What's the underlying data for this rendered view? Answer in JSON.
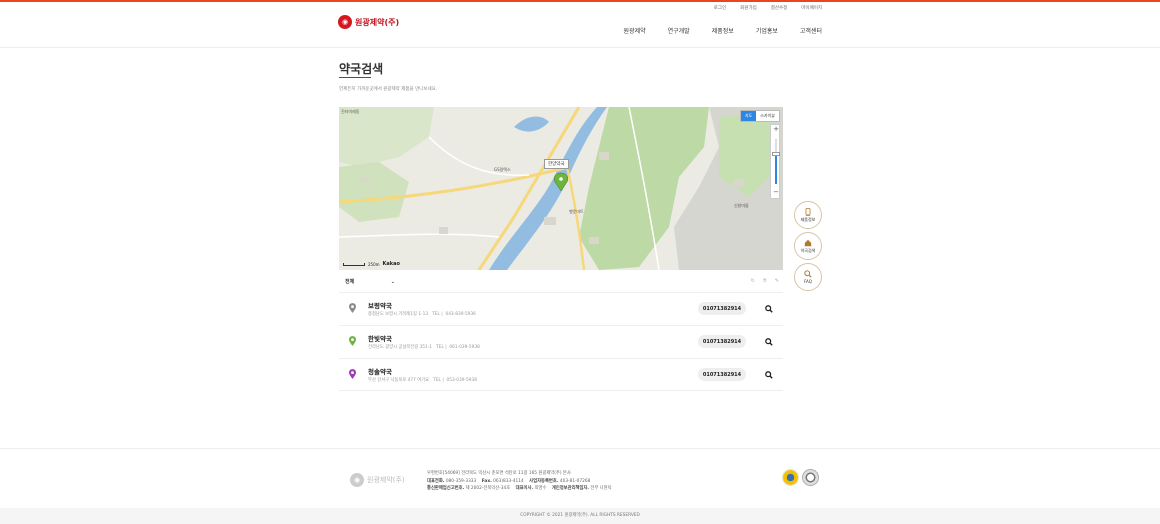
{
  "header": {
    "logo_text": "원광제약(주)",
    "util_links": [
      "로그인",
      "회원가입",
      "결산수정",
      "마이페이지"
    ],
    "nav": [
      "원광제약",
      "연구개발",
      "제품정보",
      "기업홍보",
      "고객센터"
    ]
  },
  "page": {
    "title": "약국검색",
    "subtitle": "언제든지 가까운곳에서 원광제약 제품을 만나보세요."
  },
  "map": {
    "type_buttons": [
      "지도",
      "스카이뷰"
    ],
    "active_type": "지도",
    "zoom_in": "+",
    "zoom_out": "−",
    "pin_label": "한양약국",
    "scale_label": "250m",
    "provider": "Kakao",
    "labels": [
      "진터미래동",
      "한양약국",
      "GS칼텍스",
      "행운마트",
      "신창마을"
    ]
  },
  "filter": {
    "selected": "전체",
    "chevron": "⌄",
    "tool_icons": [
      "refresh-icon",
      "bell-icon",
      "pencil-icon"
    ]
  },
  "pharmacies": [
    {
      "name": "보령약국",
      "address": "충청남도 보령시 가작례1길 1-13",
      "tel_label": "TEL",
      "tel": "043-839-5936",
      "phone_button": "01071382914",
      "pin_color": "#8a8a8a"
    },
    {
      "name": "한빛약국",
      "address": "전라남도 광양시 공설목전길 351-1",
      "tel_label": "TEL",
      "tel": "061-039-5938",
      "phone_button": "01071382914",
      "pin_color": "#6cb43c"
    },
    {
      "name": "청솔약국",
      "address": "부산 강서구 낙동북로 477 여기요",
      "tel_label": "TEL",
      "tel": "053-039-5938",
      "phone_button": "01071382914",
      "pin_color": "#9c3db5"
    }
  ],
  "quick_menu": [
    {
      "label": "제품정보",
      "icon": "phone-icon"
    },
    {
      "label": "약국검색",
      "icon": "home-icon"
    },
    {
      "label": "FAQ",
      "icon": "search-icon"
    }
  ],
  "footer": {
    "logo_text": "원광제약(주)",
    "line1": "우편번호[54069] 전라북도 익산시 춘포면 석탄로 11길 165 원광제약(주) 본사",
    "line2_label_tel": "대표전화.",
    "line2_tel": "080-359-3333",
    "line2_label_fax": "Fax.",
    "line2_fax": "063)833-4114",
    "line2_label_biz": "사업자등록번호.",
    "line2_biz": "403-81-07268",
    "line3_label_mail": "통신판매업신고번호.",
    "line3_mail": "제 2002-전북익산-34호",
    "line3_label_ceo": "대표이사.",
    "line3_ceo": "최영수",
    "line3_label_priv": "개인정보관리책임자.",
    "line3_priv": "전무 나현덕",
    "copyright": "COPYRIGHT © 2021 원광제약(주). ALL RIGHTS RESERVED"
  },
  "colors": {
    "accent": "#d7171f",
    "map_button": "#2f86e0",
    "map_pin": "#6cb43c"
  }
}
